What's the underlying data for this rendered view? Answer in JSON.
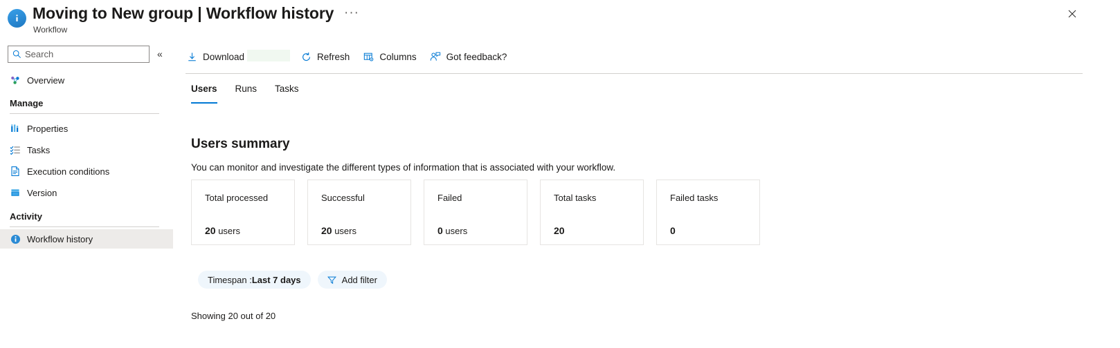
{
  "window": {
    "title": "Moving to New group | Workflow history",
    "subtitle": "Workflow",
    "more_menu": "···",
    "close_label": "Close",
    "info_icon": "info-icon"
  },
  "sidebar": {
    "search": {
      "placeholder": "Search",
      "value": "",
      "icon": "search-icon"
    },
    "collapse": {
      "icon": "double-chevron-left-icon",
      "glyph": "«"
    },
    "top_items": [
      {
        "label": "Overview",
        "icon": "overview-icon",
        "selected": false
      }
    ],
    "groups": [
      {
        "label": "Manage",
        "items": [
          {
            "label": "Properties",
            "icon": "properties-icon",
            "selected": false
          },
          {
            "label": "Tasks",
            "icon": "tasks-icon",
            "selected": false
          },
          {
            "label": "Execution conditions",
            "icon": "document-icon",
            "selected": false
          },
          {
            "label": "Version",
            "icon": "version-icon",
            "selected": false
          }
        ]
      },
      {
        "label": "Activity",
        "items": [
          {
            "label": "Workflow history",
            "icon": "info-icon",
            "selected": true
          }
        ]
      }
    ]
  },
  "toolbar": {
    "items": [
      {
        "label": "Download",
        "icon": "download-icon",
        "redacted": true
      },
      {
        "label": "Refresh",
        "icon": "refresh-icon",
        "redacted": false
      },
      {
        "label": "Columns",
        "icon": "columns-icon",
        "redacted": false
      },
      {
        "label": "Got feedback?",
        "icon": "feedback-icon",
        "redacted": false
      }
    ]
  },
  "tabs": [
    {
      "label": "Users",
      "active": true
    },
    {
      "label": "Runs",
      "active": false
    },
    {
      "label": "Tasks",
      "active": false
    }
  ],
  "main": {
    "section_title": "Users summary",
    "section_description": "You can monitor and investigate the different types of information that is associated with your workflow.",
    "cards": [
      {
        "label": "Total processed",
        "value": "20",
        "unit": "users"
      },
      {
        "label": "Successful",
        "value": "20",
        "unit": "users"
      },
      {
        "label": "Failed",
        "value": "0",
        "unit": "users"
      },
      {
        "label": "Total tasks",
        "value": "20",
        "unit": ""
      },
      {
        "label": "Failed tasks",
        "value": "0",
        "unit": ""
      }
    ],
    "filters": [
      {
        "label_prefix": "Timespan : ",
        "label_value": "Last 7 days",
        "icon": ""
      },
      {
        "label_prefix": "",
        "label_value": "Add filter",
        "icon": "filter-icon"
      }
    ],
    "showing_text": "Showing 20 out of 20"
  },
  "colors": {
    "accent": "#0078d4",
    "selected_nav_bg": "#edebe9",
    "pill_bg": "#eff6fc",
    "card_border": "#e6e4e2",
    "rule": "#d2d0ce"
  }
}
